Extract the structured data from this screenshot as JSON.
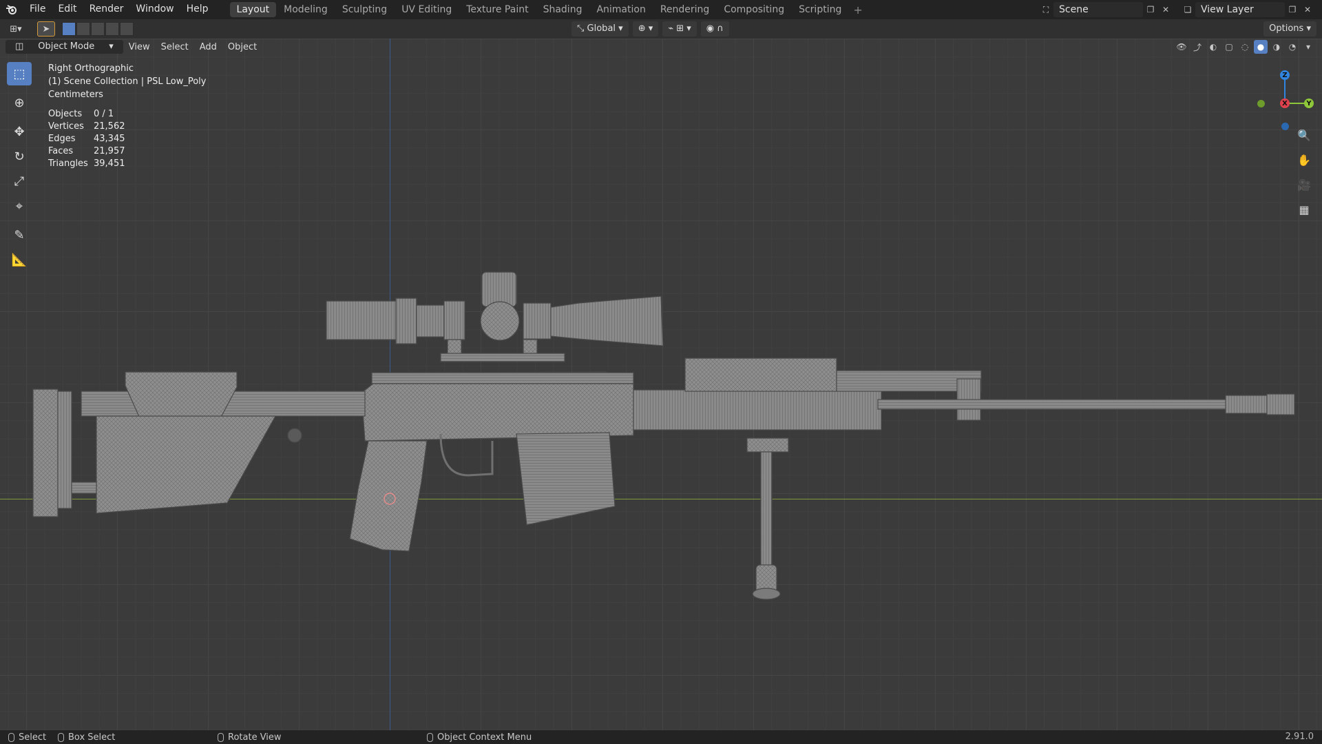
{
  "app": {
    "version": "2.91.0"
  },
  "menu": [
    "File",
    "Edit",
    "Render",
    "Window",
    "Help"
  ],
  "workspaces": [
    "Layout",
    "Modeling",
    "Sculpting",
    "UV Editing",
    "Texture Paint",
    "Shading",
    "Animation",
    "Rendering",
    "Compositing",
    "Scripting"
  ],
  "active_workspace": "Layout",
  "scene": {
    "name": "Scene",
    "view_layer": "View Layer"
  },
  "header": {
    "orientation": "Global",
    "options": "Options"
  },
  "viewport_header": {
    "mode": "Object Mode",
    "menus": [
      "View",
      "Select",
      "Add",
      "Object"
    ]
  },
  "overlay": {
    "view_name": "Right Orthographic",
    "collection": "(1) Scene Collection | PSL Low_Poly",
    "units": "Centimeters",
    "stats": [
      {
        "label": "Objects",
        "value": "0 / 1"
      },
      {
        "label": "Vertices",
        "value": "21,562"
      },
      {
        "label": "Edges",
        "value": "43,345"
      },
      {
        "label": "Faces",
        "value": "21,957"
      },
      {
        "label": "Triangles",
        "value": "39,451"
      }
    ]
  },
  "gizmo": {
    "z": "Z",
    "y": "Y",
    "x": "X",
    "colors": {
      "x": "#e0414e",
      "y": "#8fc73b",
      "z": "#2f85e0"
    }
  },
  "toolbar": [
    "select-box-icon",
    "cursor-icon",
    "move-icon",
    "rotate-icon",
    "scale-icon",
    "transform-icon",
    "annotate-icon",
    "measure-icon"
  ],
  "status": {
    "select": "Select",
    "box_select": "Box Select",
    "rotate_view": "Rotate View",
    "context_menu": "Object Context Menu"
  },
  "colors": {
    "accent": "#5680c2",
    "axis_x": "#7e9a3a",
    "axis_z": "#3d5a8f"
  }
}
